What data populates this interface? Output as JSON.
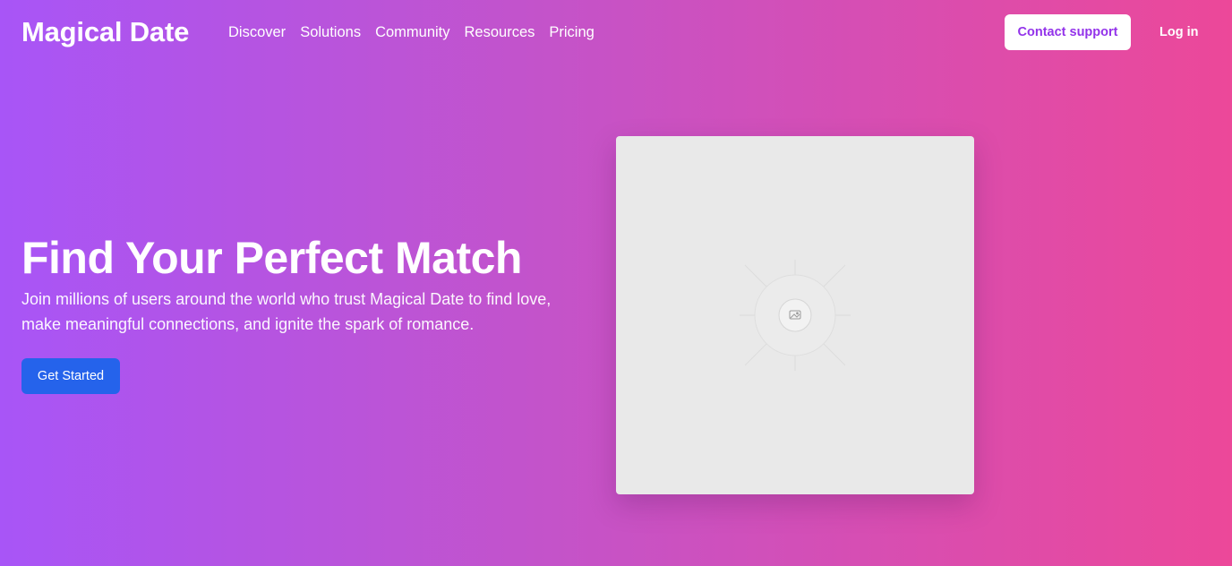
{
  "header": {
    "logo": "Magical Date",
    "nav": [
      "Discover",
      "Solutions",
      "Community",
      "Resources",
      "Pricing"
    ],
    "contact_label": "Contact support",
    "login_label": "Log in"
  },
  "hero": {
    "title": "Find Your Perfect Match",
    "subtitle_line1": "Join millions of users around the world who trust Magical Date to find love,",
    "subtitle_line2": "make meaningful connections, and ignite the spark of romance.",
    "cta_label": "Get Started"
  },
  "media": {
    "icon": "image-placeholder-icon"
  },
  "colors": {
    "gradient_start": "#a855f7",
    "gradient_end": "#ec4899",
    "cta": "#2563eb",
    "contact_text": "#9333ea",
    "placeholder_bg": "#e9e9e9"
  }
}
